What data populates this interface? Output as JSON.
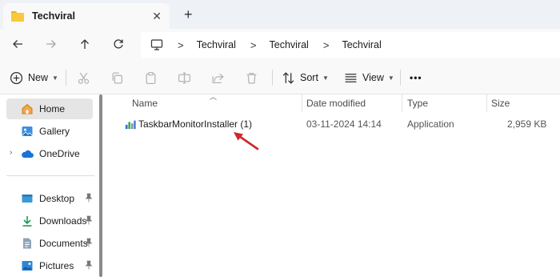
{
  "window": {
    "tab_title": "Techviral",
    "tab_close_glyph": "✕",
    "new_tab_glyph": "+"
  },
  "nav": {
    "breadcrumbs": [
      "Techviral",
      "Techviral",
      "Techviral"
    ],
    "separator": ">"
  },
  "toolbar": {
    "new_label": "New",
    "sort_label": "Sort",
    "view_label": "View",
    "more_label": "•••"
  },
  "sidebar": {
    "items": [
      {
        "label": "Home",
        "icon": "home-icon",
        "selected": true
      },
      {
        "label": "Gallery",
        "icon": "gallery-icon"
      },
      {
        "label": "OneDrive",
        "icon": "onedrive-icon",
        "expandable": true
      },
      {
        "label": "Desktop",
        "icon": "desktop-folder-icon",
        "pinned": true
      },
      {
        "label": "Downloads",
        "icon": "downloads-icon",
        "pinned": true
      },
      {
        "label": "Documents",
        "icon": "documents-icon",
        "pinned": true
      },
      {
        "label": "Pictures",
        "icon": "pictures-icon",
        "pinned": true
      }
    ]
  },
  "columns": {
    "name": "Name",
    "date_modified": "Date modified",
    "type": "Type",
    "size": "Size"
  },
  "files": [
    {
      "name": "TaskbarMonitorInstaller (1)",
      "date_modified": "03-11-2024 14:14",
      "type": "Application",
      "size": "2,959 KB",
      "icon": "installer-icon"
    }
  ],
  "colors": {
    "annotation_arrow": "#d0262d",
    "folder": "#f9c93b",
    "accent": "#0a64c8"
  }
}
